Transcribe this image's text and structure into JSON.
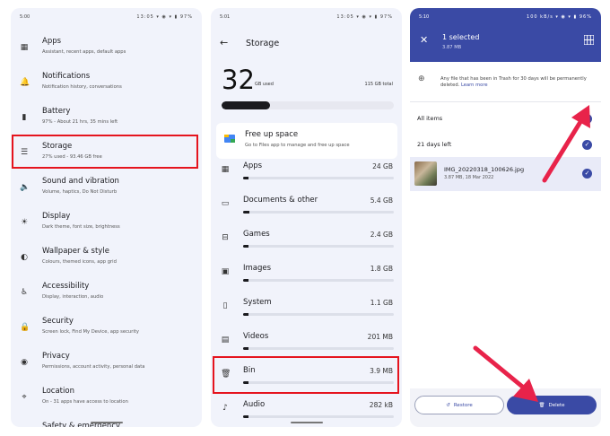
{
  "colors": {
    "highlight": "#e5141e",
    "accent": "#3a4aa5",
    "arrow": "#e8234a"
  },
  "settings_screen": {
    "status": {
      "time": "5:00",
      "right": "13:05 ▾ ◉ ▾ ▮ 97%"
    },
    "items": [
      {
        "icon": "apps-grid-icon",
        "title": "Apps",
        "subtitle": "Assistant, recent apps, default apps"
      },
      {
        "icon": "bell-icon",
        "title": "Notifications",
        "subtitle": "Notification history, conversations"
      },
      {
        "icon": "battery-icon",
        "title": "Battery",
        "subtitle": "97% - About 21 hrs, 35 mins left"
      },
      {
        "icon": "storage-list-icon",
        "title": "Storage",
        "subtitle": "27% used - 93.46 GB free"
      },
      {
        "icon": "speaker-icon",
        "title": "Sound and vibration",
        "subtitle": "Volume, haptics, Do Not Disturb"
      },
      {
        "icon": "brightness-icon",
        "title": "Display",
        "subtitle": "Dark theme, font size, brightness"
      },
      {
        "icon": "palette-icon",
        "title": "Wallpaper & style",
        "subtitle": "Colours, themed icons, app grid"
      },
      {
        "icon": "accessibility-icon",
        "title": "Accessibility",
        "subtitle": "Display, interaction, audio"
      },
      {
        "icon": "lock-icon",
        "title": "Security",
        "subtitle": "Screen lock, Find My Device, app security"
      },
      {
        "icon": "eye-icon",
        "title": "Privacy",
        "subtitle": "Permissions, account activity, personal data"
      },
      {
        "icon": "location-pin-icon",
        "title": "Location",
        "subtitle": "On - 31 apps have access to location"
      },
      {
        "icon": "shield-icon",
        "title": "Safety & emergency",
        "subtitle": ""
      }
    ]
  },
  "storage_screen": {
    "status": {
      "time": "5:01",
      "right": "13:05 ▾ ◉ ▾ ▮ 97%"
    },
    "title": "Storage",
    "used_number": "32",
    "used_unit": "GB used",
    "total": "115 GB total",
    "used_fraction": 0.28,
    "free_up": {
      "title": "Free up space",
      "subtitle": "Go to Files app to manage and free up space"
    },
    "categories": [
      {
        "icon": "apps-grid-icon",
        "name": "Apps",
        "size": "24 GB",
        "fraction": 0.0
      },
      {
        "icon": "folder-icon",
        "name": "Documents & other",
        "size": "5.4 GB",
        "fraction": 0.04
      },
      {
        "icon": "gamepad-icon",
        "name": "Games",
        "size": "2.4 GB",
        "fraction": 0.0
      },
      {
        "icon": "image-icon",
        "name": "Images",
        "size": "1.8 GB",
        "fraction": 0.0
      },
      {
        "icon": "phone-system-icon",
        "name": "System",
        "size": "1.1 GB",
        "fraction": 0.0
      },
      {
        "icon": "video-icon",
        "name": "Videos",
        "size": "201 MB",
        "fraction": 0.0
      },
      {
        "icon": "trash-icon",
        "name": "Bin",
        "size": "3.9 MB",
        "fraction": 0.0
      },
      {
        "icon": "music-note-icon",
        "name": "Audio",
        "size": "282 kB",
        "fraction": 0.0
      }
    ]
  },
  "bin_screen": {
    "status": {
      "time": "5:10",
      "right": "100 kB/s ▾ ◉ ▾ ▮ 96%"
    },
    "selected": "1 selected",
    "selected_size": "3.87 MB",
    "info": "Any file that has been in Trash for 30 days will be permanently deleted.",
    "learn_more": "Learn more",
    "all_items": "All items",
    "days_left": "21 days left",
    "file": {
      "name": "IMG_20220318_100626.jpg",
      "meta": "3.87 MB, 18 Mar 2022"
    },
    "restore_label": "Restore",
    "delete_label": "Delete"
  }
}
